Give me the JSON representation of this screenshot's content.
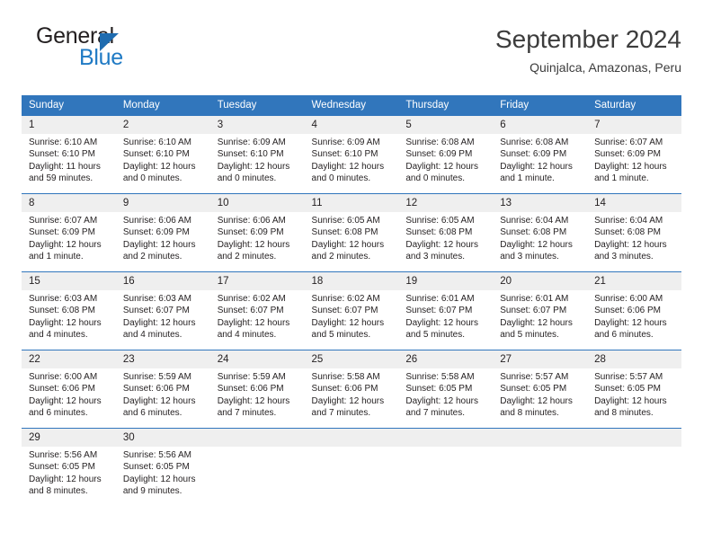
{
  "brand": {
    "name_top": "General",
    "name_bottom": "Blue",
    "accent_dark": "#1f6cb0",
    "accent_light": "#1f7ac4"
  },
  "header": {
    "title": "September 2024",
    "subtitle": "Quinjalca, Amazonas, Peru"
  },
  "theme": {
    "header_bg": "#3176bc",
    "daynum_bg": "#efefef",
    "text": "#231f20"
  },
  "calendar": {
    "weekdays": [
      "Sunday",
      "Monday",
      "Tuesday",
      "Wednesday",
      "Thursday",
      "Friday",
      "Saturday"
    ],
    "weeks": [
      [
        {
          "day": "1",
          "sunrise": "Sunrise: 6:10 AM",
          "sunset": "Sunset: 6:10 PM",
          "daylight_1": "Daylight: 11 hours",
          "daylight_2": "and 59 minutes."
        },
        {
          "day": "2",
          "sunrise": "Sunrise: 6:10 AM",
          "sunset": "Sunset: 6:10 PM",
          "daylight_1": "Daylight: 12 hours",
          "daylight_2": "and 0 minutes."
        },
        {
          "day": "3",
          "sunrise": "Sunrise: 6:09 AM",
          "sunset": "Sunset: 6:10 PM",
          "daylight_1": "Daylight: 12 hours",
          "daylight_2": "and 0 minutes."
        },
        {
          "day": "4",
          "sunrise": "Sunrise: 6:09 AM",
          "sunset": "Sunset: 6:10 PM",
          "daylight_1": "Daylight: 12 hours",
          "daylight_2": "and 0 minutes."
        },
        {
          "day": "5",
          "sunrise": "Sunrise: 6:08 AM",
          "sunset": "Sunset: 6:09 PM",
          "daylight_1": "Daylight: 12 hours",
          "daylight_2": "and 0 minutes."
        },
        {
          "day": "6",
          "sunrise": "Sunrise: 6:08 AM",
          "sunset": "Sunset: 6:09 PM",
          "daylight_1": "Daylight: 12 hours",
          "daylight_2": "and 1 minute."
        },
        {
          "day": "7",
          "sunrise": "Sunrise: 6:07 AM",
          "sunset": "Sunset: 6:09 PM",
          "daylight_1": "Daylight: 12 hours",
          "daylight_2": "and 1 minute."
        }
      ],
      [
        {
          "day": "8",
          "sunrise": "Sunrise: 6:07 AM",
          "sunset": "Sunset: 6:09 PM",
          "daylight_1": "Daylight: 12 hours",
          "daylight_2": "and 1 minute."
        },
        {
          "day": "9",
          "sunrise": "Sunrise: 6:06 AM",
          "sunset": "Sunset: 6:09 PM",
          "daylight_1": "Daylight: 12 hours",
          "daylight_2": "and 2 minutes."
        },
        {
          "day": "10",
          "sunrise": "Sunrise: 6:06 AM",
          "sunset": "Sunset: 6:09 PM",
          "daylight_1": "Daylight: 12 hours",
          "daylight_2": "and 2 minutes."
        },
        {
          "day": "11",
          "sunrise": "Sunrise: 6:05 AM",
          "sunset": "Sunset: 6:08 PM",
          "daylight_1": "Daylight: 12 hours",
          "daylight_2": "and 2 minutes."
        },
        {
          "day": "12",
          "sunrise": "Sunrise: 6:05 AM",
          "sunset": "Sunset: 6:08 PM",
          "daylight_1": "Daylight: 12 hours",
          "daylight_2": "and 3 minutes."
        },
        {
          "day": "13",
          "sunrise": "Sunrise: 6:04 AM",
          "sunset": "Sunset: 6:08 PM",
          "daylight_1": "Daylight: 12 hours",
          "daylight_2": "and 3 minutes."
        },
        {
          "day": "14",
          "sunrise": "Sunrise: 6:04 AM",
          "sunset": "Sunset: 6:08 PM",
          "daylight_1": "Daylight: 12 hours",
          "daylight_2": "and 3 minutes."
        }
      ],
      [
        {
          "day": "15",
          "sunrise": "Sunrise: 6:03 AM",
          "sunset": "Sunset: 6:08 PM",
          "daylight_1": "Daylight: 12 hours",
          "daylight_2": "and 4 minutes."
        },
        {
          "day": "16",
          "sunrise": "Sunrise: 6:03 AM",
          "sunset": "Sunset: 6:07 PM",
          "daylight_1": "Daylight: 12 hours",
          "daylight_2": "and 4 minutes."
        },
        {
          "day": "17",
          "sunrise": "Sunrise: 6:02 AM",
          "sunset": "Sunset: 6:07 PM",
          "daylight_1": "Daylight: 12 hours",
          "daylight_2": "and 4 minutes."
        },
        {
          "day": "18",
          "sunrise": "Sunrise: 6:02 AM",
          "sunset": "Sunset: 6:07 PM",
          "daylight_1": "Daylight: 12 hours",
          "daylight_2": "and 5 minutes."
        },
        {
          "day": "19",
          "sunrise": "Sunrise: 6:01 AM",
          "sunset": "Sunset: 6:07 PM",
          "daylight_1": "Daylight: 12 hours",
          "daylight_2": "and 5 minutes."
        },
        {
          "day": "20",
          "sunrise": "Sunrise: 6:01 AM",
          "sunset": "Sunset: 6:07 PM",
          "daylight_1": "Daylight: 12 hours",
          "daylight_2": "and 5 minutes."
        },
        {
          "day": "21",
          "sunrise": "Sunrise: 6:00 AM",
          "sunset": "Sunset: 6:06 PM",
          "daylight_1": "Daylight: 12 hours",
          "daylight_2": "and 6 minutes."
        }
      ],
      [
        {
          "day": "22",
          "sunrise": "Sunrise: 6:00 AM",
          "sunset": "Sunset: 6:06 PM",
          "daylight_1": "Daylight: 12 hours",
          "daylight_2": "and 6 minutes."
        },
        {
          "day": "23",
          "sunrise": "Sunrise: 5:59 AM",
          "sunset": "Sunset: 6:06 PM",
          "daylight_1": "Daylight: 12 hours",
          "daylight_2": "and 6 minutes."
        },
        {
          "day": "24",
          "sunrise": "Sunrise: 5:59 AM",
          "sunset": "Sunset: 6:06 PM",
          "daylight_1": "Daylight: 12 hours",
          "daylight_2": "and 7 minutes."
        },
        {
          "day": "25",
          "sunrise": "Sunrise: 5:58 AM",
          "sunset": "Sunset: 6:06 PM",
          "daylight_1": "Daylight: 12 hours",
          "daylight_2": "and 7 minutes."
        },
        {
          "day": "26",
          "sunrise": "Sunrise: 5:58 AM",
          "sunset": "Sunset: 6:05 PM",
          "daylight_1": "Daylight: 12 hours",
          "daylight_2": "and 7 minutes."
        },
        {
          "day": "27",
          "sunrise": "Sunrise: 5:57 AM",
          "sunset": "Sunset: 6:05 PM",
          "daylight_1": "Daylight: 12 hours",
          "daylight_2": "and 8 minutes."
        },
        {
          "day": "28",
          "sunrise": "Sunrise: 5:57 AM",
          "sunset": "Sunset: 6:05 PM",
          "daylight_1": "Daylight: 12 hours",
          "daylight_2": "and 8 minutes."
        }
      ],
      [
        {
          "day": "29",
          "sunrise": "Sunrise: 5:56 AM",
          "sunset": "Sunset: 6:05 PM",
          "daylight_1": "Daylight: 12 hours",
          "daylight_2": "and 8 minutes."
        },
        {
          "day": "30",
          "sunrise": "Sunrise: 5:56 AM",
          "sunset": "Sunset: 6:05 PM",
          "daylight_1": "Daylight: 12 hours",
          "daylight_2": "and 9 minutes."
        },
        {
          "day": "",
          "sunrise": "",
          "sunset": "",
          "daylight_1": "",
          "daylight_2": ""
        },
        {
          "day": "",
          "sunrise": "",
          "sunset": "",
          "daylight_1": "",
          "daylight_2": ""
        },
        {
          "day": "",
          "sunrise": "",
          "sunset": "",
          "daylight_1": "",
          "daylight_2": ""
        },
        {
          "day": "",
          "sunrise": "",
          "sunset": "",
          "daylight_1": "",
          "daylight_2": ""
        },
        {
          "day": "",
          "sunrise": "",
          "sunset": "",
          "daylight_1": "",
          "daylight_2": ""
        }
      ]
    ]
  }
}
